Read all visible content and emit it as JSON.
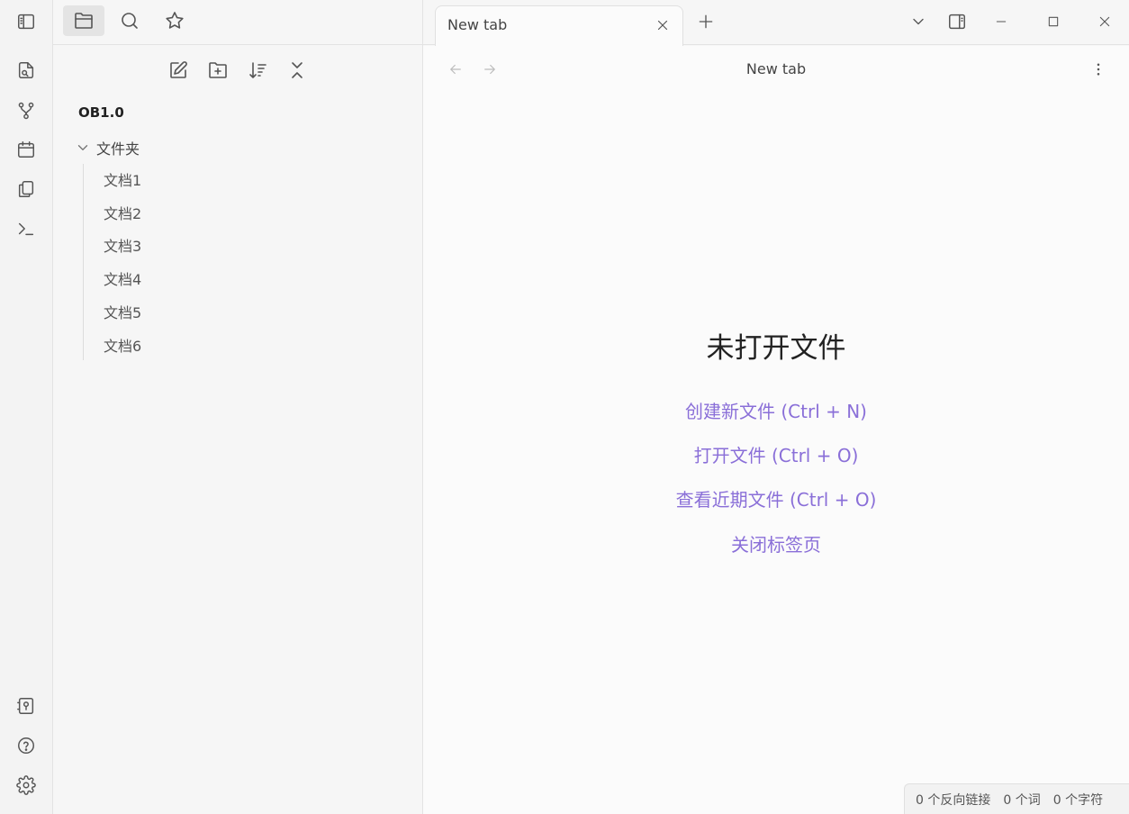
{
  "ribbon": {
    "top_icons": [
      "quick-switcher-icon",
      "graph-view-icon",
      "calendar-icon",
      "templates-icon",
      "command-palette-icon"
    ],
    "bottom_icons": [
      "vault-switch-icon",
      "help-icon",
      "settings-icon"
    ]
  },
  "sidebar": {
    "tabs": [
      "files",
      "search",
      "bookmarks"
    ],
    "active_tab": "files",
    "vault_name": "OB1.0",
    "folder": {
      "name": "文件夹",
      "files": [
        "文档1",
        "文档2",
        "文档3",
        "文档4",
        "文档5",
        "文档6"
      ]
    }
  },
  "tabs": {
    "active_title": "New tab"
  },
  "main": {
    "header_title": "New tab",
    "empty_title": "未打开文件",
    "actions": {
      "create": "创建新文件 (Ctrl + N)",
      "open": "打开文件 (Ctrl + O)",
      "recent": "查看近期文件 (Ctrl + O)",
      "close": "关闭标签页"
    }
  },
  "statusbar": {
    "backlinks": "0 个反向链接",
    "words": "0 个词",
    "chars": "0 个字符"
  },
  "colors": {
    "accent_link": "#8a6fd8"
  }
}
